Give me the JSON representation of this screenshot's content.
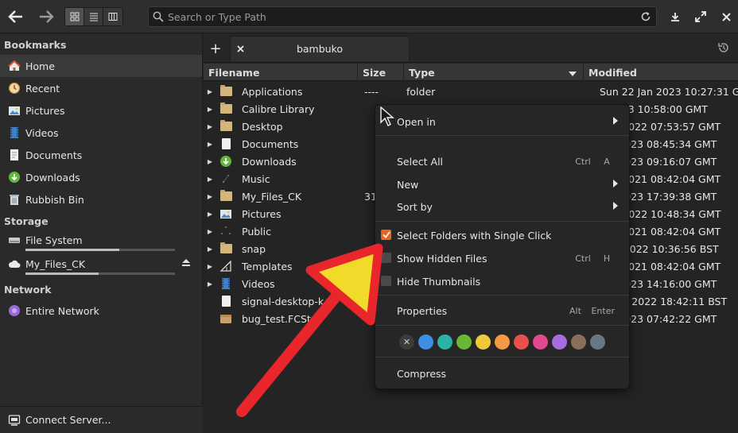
{
  "header": {
    "search_placeholder": "Search or Type Path",
    "icons": [
      "back-arrow-icon",
      "forward-arrow-icon",
      "grid-view-icon",
      "list-view-icon",
      "column-view-icon",
      "search-icon",
      "reload-icon",
      "download-icon",
      "maximize-icon",
      "close-icon"
    ]
  },
  "sidebar": {
    "bookmarks_label": "Bookmarks",
    "bookmarks": [
      {
        "label": "Home",
        "icon": "home-icon"
      },
      {
        "label": "Recent",
        "icon": "recent-icon"
      },
      {
        "label": "Pictures",
        "icon": "pictures-icon"
      },
      {
        "label": "Videos",
        "icon": "videos-icon"
      },
      {
        "label": "Documents",
        "icon": "documents-icon"
      },
      {
        "label": "Downloads",
        "icon": "downloads-icon"
      },
      {
        "label": "Rubbish Bin",
        "icon": "trash-icon"
      }
    ],
    "storage_label": "Storage",
    "volumes": [
      {
        "label": "File System",
        "usage": 0.63
      },
      {
        "label": "My_Files_CK",
        "usage": 0.49
      }
    ],
    "network_label": "Network",
    "network": [
      {
        "label": "Entire Network",
        "icon": "network-icon"
      }
    ],
    "connect_server": "Connect Server..."
  },
  "tabs": [
    {
      "label": "bambuko"
    }
  ],
  "columns": {
    "filename": "Filename",
    "size": "Size",
    "type": "Type",
    "modified": "Modified"
  },
  "files": [
    {
      "name": "Applications",
      "size": "----",
      "type": "folder",
      "modified": "Sun 22 Jan 2023 10:27:31 GMT",
      "icon": "folder"
    },
    {
      "name": "Calibre Library",
      "size": "",
      "type": "",
      "modified": "n 2023 10:58:00 GMT",
      "icon": "folder"
    },
    {
      "name": "Desktop",
      "size": "",
      "type": "",
      "modified": "Dec 2022 07:53:57 GMT",
      "icon": "folder"
    },
    {
      "name": "Documents",
      "size": "",
      "type": "",
      "modified": "Jan 2023 08:45:34 GMT",
      "icon": "doc"
    },
    {
      "name": "Downloads",
      "size": "",
      "type": "",
      "modified": "Jan 2023 09:16:07 GMT",
      "icon": "download"
    },
    {
      "name": "Music",
      "size": "",
      "type": "",
      "modified": "Dec 2021 08:42:04 GMT",
      "icon": "music"
    },
    {
      "name": "My_Files_CK",
      "size": "31",
      "type": "",
      "modified": "Jan 2023 17:39:38 GMT",
      "icon": "folder"
    },
    {
      "name": "Pictures",
      "size": "",
      "type": "",
      "modified": "Nov 2022 10:48:34 GMT",
      "icon": "pictures"
    },
    {
      "name": "Public",
      "size": "",
      "type": "",
      "modified": "Dec 2021 08:42:04 GMT",
      "icon": "public"
    },
    {
      "name": "snap",
      "size": "",
      "type": "",
      "modified": "May 2022 10:36:56 BST",
      "icon": "folder"
    },
    {
      "name": "Templates",
      "size": "",
      "type": "",
      "modified": "Dec 2021 08:42:04 GMT",
      "icon": "templates"
    },
    {
      "name": "Videos",
      "size": "",
      "type": "",
      "modified": "Jan 2023 14:16:00 GMT",
      "icon": "videos"
    },
    {
      "name": "signal-desktop-k...",
      "size": "",
      "type": "",
      "modified": "1 Aug 2022 18:42:11 BST",
      "icon": "doc"
    },
    {
      "name": "bug_test.FCStd",
      "size": "",
      "type": "",
      "modified": "Jan 2023 07:42:22 GMT",
      "icon": "fcstd"
    }
  ],
  "context_menu": {
    "open_in": "Open in",
    "select_all": "Select All",
    "select_all_keys": [
      "Ctrl",
      "A"
    ],
    "new": "New",
    "sort_by": "Sort by",
    "single_click": "Select Folders with Single Click",
    "single_click_checked": true,
    "show_hidden": "Show Hidden Files",
    "show_hidden_keys": [
      "Ctrl",
      "H"
    ],
    "show_hidden_checked": false,
    "hide_thumbs": "Hide Thumbnails",
    "hide_thumbs_checked": false,
    "properties": "Properties",
    "properties_keys": [
      "Alt",
      "Enter"
    ],
    "compress": "Compress",
    "colors": [
      "#3d8ee5",
      "#2bb3a3",
      "#6ab637",
      "#f0c93b",
      "#f39a43",
      "#e8504b",
      "#e34a8d",
      "#a86ce0",
      "#8a6d5a",
      "#667885"
    ]
  }
}
